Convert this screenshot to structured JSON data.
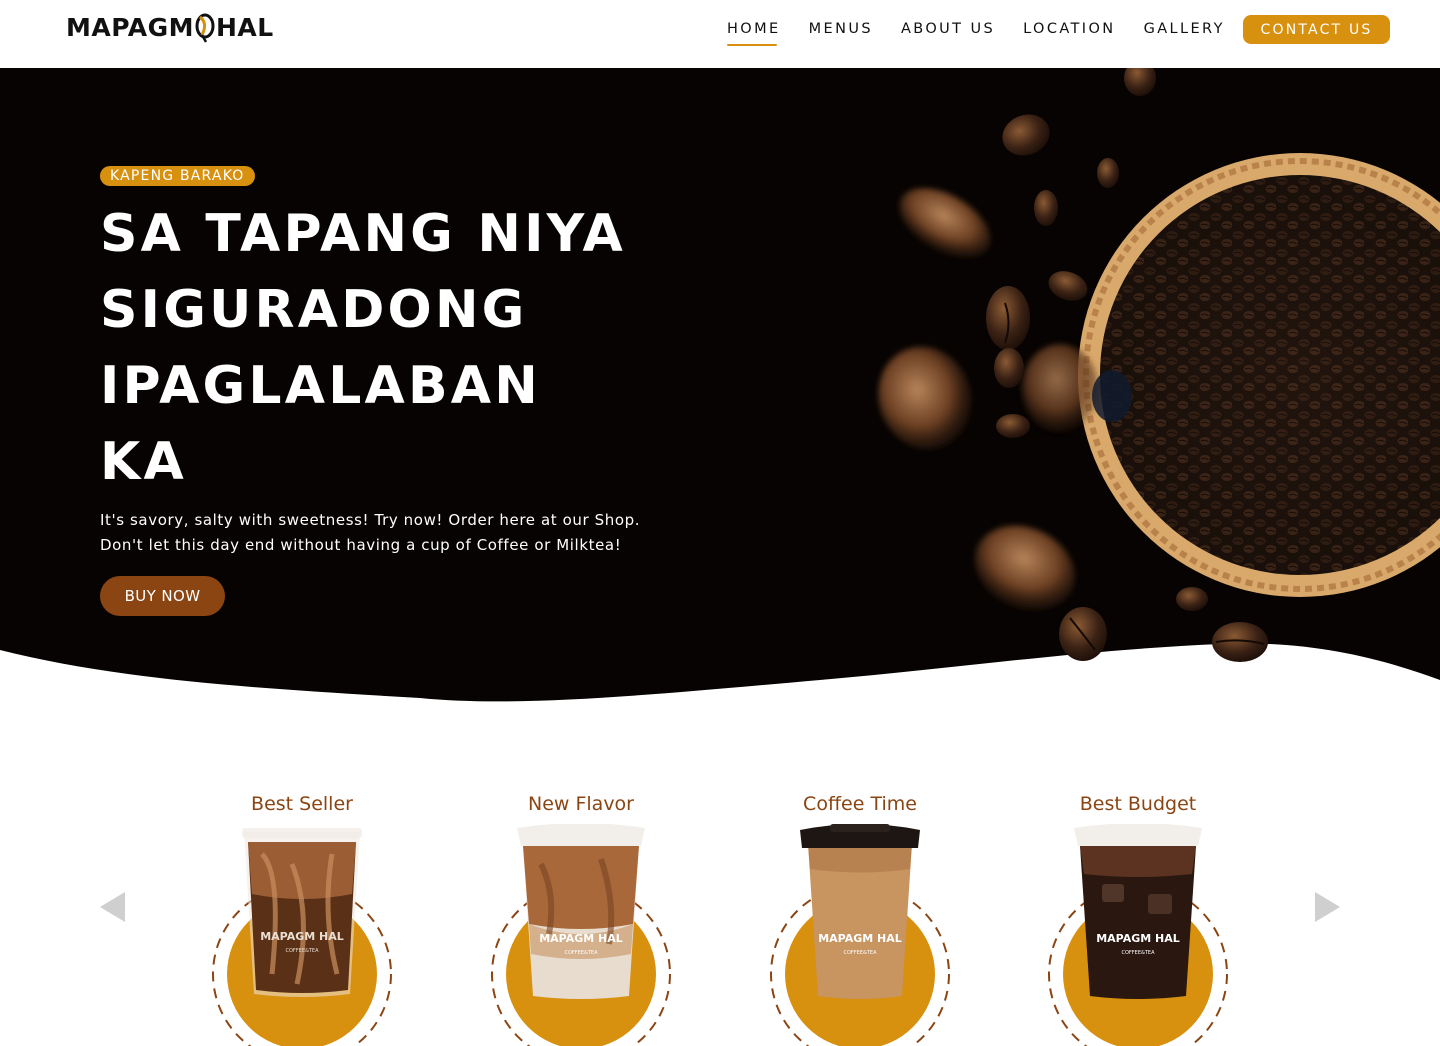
{
  "header": {
    "logo_left": "MAPAGM",
    "logo_right": "HAL",
    "nav": [
      {
        "label": "HOME",
        "active": true
      },
      {
        "label": "MENUS",
        "active": false
      },
      {
        "label": "ABOUT US",
        "active": false
      },
      {
        "label": "LOCATION",
        "active": false
      },
      {
        "label": "GALLERY",
        "active": false
      }
    ],
    "contact_label": "CONTACT US"
  },
  "hero": {
    "tag": "KAPENG BARAKO",
    "title_lines": [
      "SA TAPANG NIYA",
      "SIGURADONG",
      "IPAGLALABAN",
      "KA"
    ],
    "description_lines": [
      "It's savory, salty with sweetness! Try now! Order here at our Shop.",
      "Don't let this day end without having a cup of Coffee or Milktea!"
    ],
    "buy_label": "BUY NOW"
  },
  "products": [
    {
      "title": "Best Seller",
      "drink": "iced-coffee-icon",
      "cup_logo": "MAPAGM HAL",
      "cup_sub": "COFFEE&TEA"
    },
    {
      "title": "New Flavor",
      "drink": "iced-latte-icon",
      "cup_logo": "MAPAGM HAL",
      "cup_sub": "COFFEE&TEA"
    },
    {
      "title": "Coffee Time",
      "drink": "hot-coffee-cup-icon",
      "cup_logo": "MAPAGM HAL",
      "cup_sub": "COFFEE&TEA"
    },
    {
      "title": "Best Budget",
      "drink": "iced-americano-icon",
      "cup_logo": "MAPAGM HAL",
      "cup_sub": "COFFEE&TEA"
    }
  ],
  "colors": {
    "accent": "#d8900f",
    "brown": "#8b4513",
    "hero_bg": "#060302",
    "arrow": "#cfcfcf"
  }
}
